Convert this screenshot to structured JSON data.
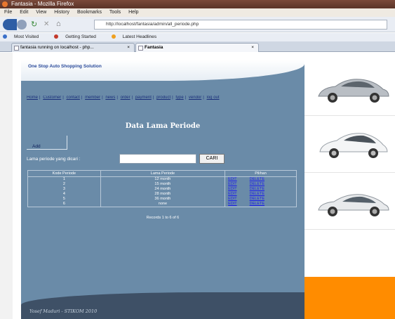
{
  "browser": {
    "window_title": "Fantasia - Mozilla Firefox",
    "menu": [
      "File",
      "Edit",
      "View",
      "History",
      "Bookmarks",
      "Tools",
      "Help"
    ],
    "url": "http://localhost/fantasia/admin/all_periode.php",
    "bookmarks": [
      "Most Visited",
      "Getting Started",
      "Latest Headlines"
    ],
    "tabs": [
      {
        "title": "fantasia running on localhost - php..."
      },
      {
        "title": "Fantasia"
      }
    ],
    "tab_close": "×"
  },
  "site": {
    "tagline": "One Stop Auto Shopping Solution",
    "nav": [
      "Home",
      "Customer",
      "contact",
      "member",
      "news",
      "order",
      "payment",
      "product",
      "type",
      "vendor",
      "log out"
    ],
    "nav_separator": "|",
    "page_title": "Data Lama Periode",
    "add_label": "Add",
    "search_label": "Lama periode yang dicari :",
    "search_value": "",
    "search_button": "CARI",
    "table": {
      "headers": [
        "Kode Periode",
        "Lama Periode",
        "Pilihan"
      ],
      "rows": [
        {
          "kode": "1",
          "lama": "12 month",
          "edit": "EDIT",
          "delete": "DELETE"
        },
        {
          "kode": "2",
          "lama": "15 month",
          "edit": "EDIT",
          "delete": "DELETE"
        },
        {
          "kode": "3",
          "lama": "24 month",
          "edit": "EDIT",
          "delete": "DELETE"
        },
        {
          "kode": "4",
          "lama": "28 month",
          "edit": "EDIT",
          "delete": "DELETE"
        },
        {
          "kode": "5",
          "lama": "36 month",
          "edit": "EDIT",
          "delete": "DELETE"
        },
        {
          "kode": "6",
          "lama": "none",
          "edit": "EDIT",
          "delete": "DELETE"
        }
      ]
    },
    "records": "Records 1 to 6 of 6",
    "footer": "Yosef Maduri - STIKOM 2010"
  },
  "colors": {
    "main_panel": "#6a8ba8",
    "footer": "#3e5066",
    "accent_orange": "#ff8c00"
  }
}
